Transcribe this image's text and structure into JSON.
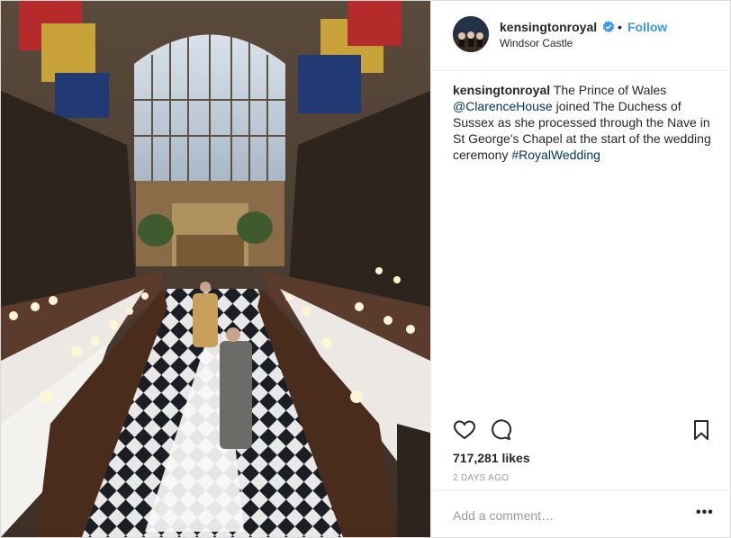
{
  "post": {
    "photo_alt": "",
    "username": "kensingtonroyal",
    "location": "Windsor Castle",
    "follow_label": "Follow",
    "dot": "•",
    "caption": {
      "username": "kensingtonroyal",
      "text_1": "The Prince of Wales",
      "mention": "@ClarenceHouse",
      "text_2": "joined The Duchess of Sussex as she processed through the Nave in St George's Chapel at the start of the wedding ceremony",
      "hashtag": "#RoyalWedding"
    },
    "likes": "717,281 likes",
    "time_ago": "2 DAYS AGO",
    "comment_placeholder": "Add a comment…",
    "more": "•••"
  },
  "icons": {
    "verified": "verified-badge-icon",
    "like": "heart-icon",
    "comment": "comment-bubble-icon",
    "save": "bookmark-icon",
    "more": "more-options-icon"
  },
  "colors": {
    "link": "#3897f0",
    "hashtag": "#003569",
    "text": "#262626",
    "muted": "#999999",
    "border": "#efefef"
  }
}
